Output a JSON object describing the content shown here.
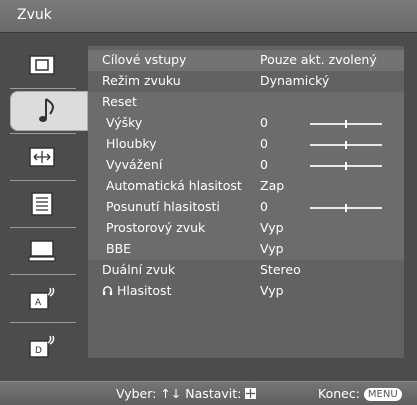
{
  "title": "Zvuk",
  "sidebar": {
    "items": [
      {
        "icon": "picture-icon"
      },
      {
        "icon": "music-note-icon",
        "active": true
      },
      {
        "icon": "screen-icon"
      },
      {
        "icon": "list-settings-icon"
      },
      {
        "icon": "pc-icon"
      },
      {
        "icon": "analog-setup-icon"
      },
      {
        "icon": "digital-setup-icon"
      }
    ]
  },
  "menu": {
    "rows": [
      {
        "label": "Cílové vstupy",
        "value": "Pouze akt. zvolený"
      },
      {
        "label": "Režim zvuku",
        "value": "Dynamický"
      },
      {
        "label": "Reset",
        "value": ""
      },
      {
        "label": "Výšky",
        "value": "0",
        "slider": 0
      },
      {
        "label": "Hloubky",
        "value": "0",
        "slider": 0
      },
      {
        "label": "Vyvážení",
        "value": "0",
        "slider": 0
      },
      {
        "label": "Automatická hlasitost",
        "value": "Zap"
      },
      {
        "label": "Posunutí hlasitosti",
        "value": "0",
        "slider": 0
      },
      {
        "label": "Prostorový zvuk",
        "value": "Vyp"
      },
      {
        "label": "BBE",
        "value": "Vyp"
      },
      {
        "label": "Duální zvuk",
        "value": "Stereo"
      },
      {
        "label": "Hlasitost",
        "value": "Vyp"
      }
    ]
  },
  "footer": {
    "select_label": "Vyber:",
    "set_label": "Nastavit:",
    "exit_label": "Konec:",
    "menu_button": "MENU"
  }
}
